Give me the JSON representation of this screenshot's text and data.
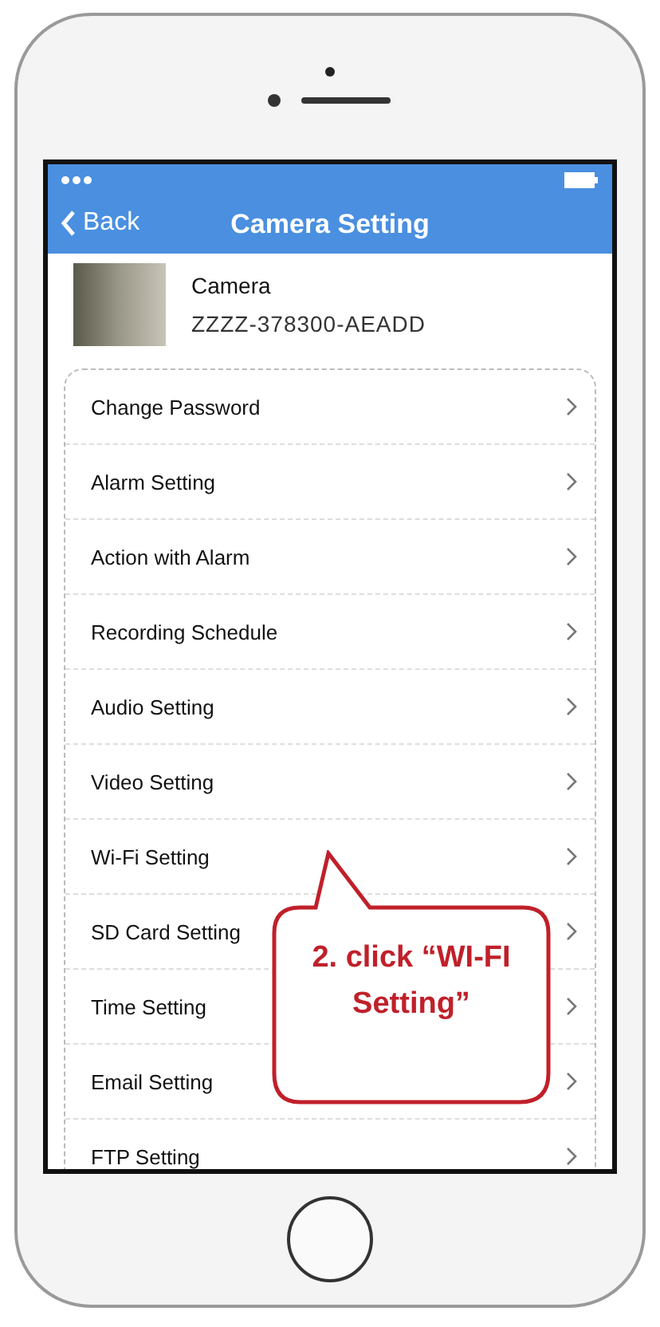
{
  "nav": {
    "back": "Back",
    "title": "Camera Setting"
  },
  "camera": {
    "name": "Camera",
    "id": "ZZZZ-378300-AEADD"
  },
  "menu": [
    {
      "label": "Change Password"
    },
    {
      "label": "Alarm Setting"
    },
    {
      "label": "Action with Alarm"
    },
    {
      "label": "Recording Schedule"
    },
    {
      "label": "Audio Setting"
    },
    {
      "label": "Video Setting"
    },
    {
      "label": "Wi-Fi Setting"
    },
    {
      "label": "SD Card Setting"
    },
    {
      "label": "Time Setting"
    },
    {
      "label": "Email Setting"
    },
    {
      "label": "FTP Setting"
    }
  ],
  "callout": {
    "text": "2. click “WI-FI Setting”"
  }
}
